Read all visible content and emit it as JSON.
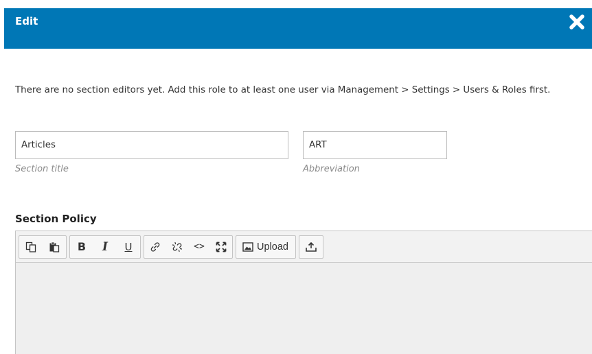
{
  "dialog": {
    "title": "Edit",
    "close_icon": "close-icon",
    "header_color": "#0077b6"
  },
  "notice": {
    "text": "There are no section editors yet. Add this role to at least one user via Management > Settings > Users & Roles first."
  },
  "form": {
    "section_title": {
      "value": "Articles",
      "label": "Section title"
    },
    "abbreviation": {
      "value": "ART",
      "label": "Abbreviation"
    },
    "section_policy": {
      "label": "Section Policy"
    }
  },
  "editor": {
    "toolbar_groups": [
      [
        "copy-icon",
        "paste-icon"
      ],
      [
        "bold-icon",
        "italic-icon",
        "underline-icon"
      ],
      [
        "link-icon",
        "unlink-icon",
        "code-icon",
        "fullscreen-icon"
      ],
      [
        "image-icon"
      ],
      [
        "upload-icon"
      ]
    ],
    "bold_glyph": "B",
    "italic_glyph": "I",
    "underline_glyph": "U",
    "code_glyph": "<>",
    "upload_label": "Upload",
    "content": ""
  }
}
